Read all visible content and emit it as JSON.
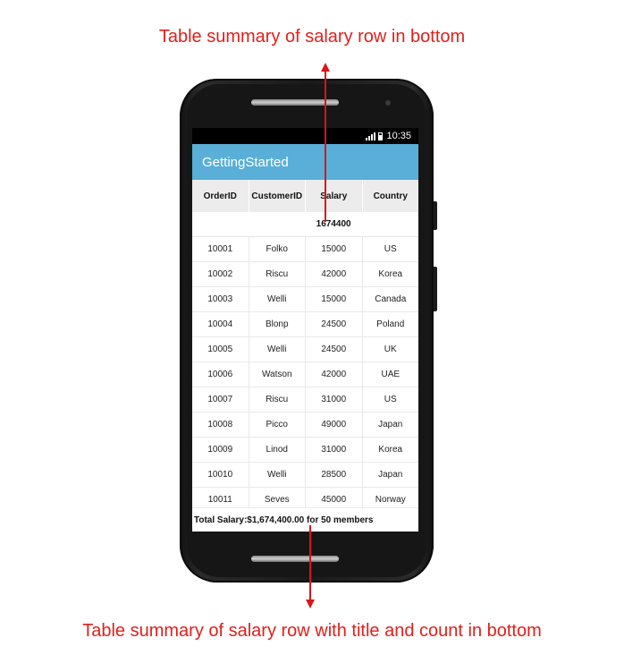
{
  "annotations": {
    "top": "Table summary of salary row in bottom",
    "bottom": "Table summary of salary row with title and count in bottom"
  },
  "status_bar": {
    "time": "10:35"
  },
  "app": {
    "title": "GettingStarted"
  },
  "grid": {
    "columns": [
      "OrderID",
      "CustomerID",
      "Salary",
      "Country"
    ],
    "top_summary": [
      "",
      "",
      "1674400",
      ""
    ],
    "rows": [
      [
        "10001",
        "Folko",
        "15000",
        "US"
      ],
      [
        "10002",
        "Riscu",
        "42000",
        "Korea"
      ],
      [
        "10003",
        "Welli",
        "15000",
        "Canada"
      ],
      [
        "10004",
        "Blonp",
        "24500",
        "Poland"
      ],
      [
        "10005",
        "Welli",
        "24500",
        "UK"
      ],
      [
        "10006",
        "Watson",
        "42000",
        "UAE"
      ],
      [
        "10007",
        "Riscu",
        "31000",
        "US"
      ],
      [
        "10008",
        "Picco",
        "49000",
        "Japan"
      ],
      [
        "10009",
        "Linod",
        "31000",
        "Korea"
      ],
      [
        "10010",
        "Welli",
        "28500",
        "Japan"
      ],
      [
        "10011",
        "Seves",
        "45000",
        "Norway"
      ]
    ],
    "footer_summary": "Total Salary:$1,674,400.00 for 50 members"
  },
  "colors": {
    "annotation": "#e0201c",
    "appbar": "#59afd7",
    "header_bg": "#ececec"
  }
}
